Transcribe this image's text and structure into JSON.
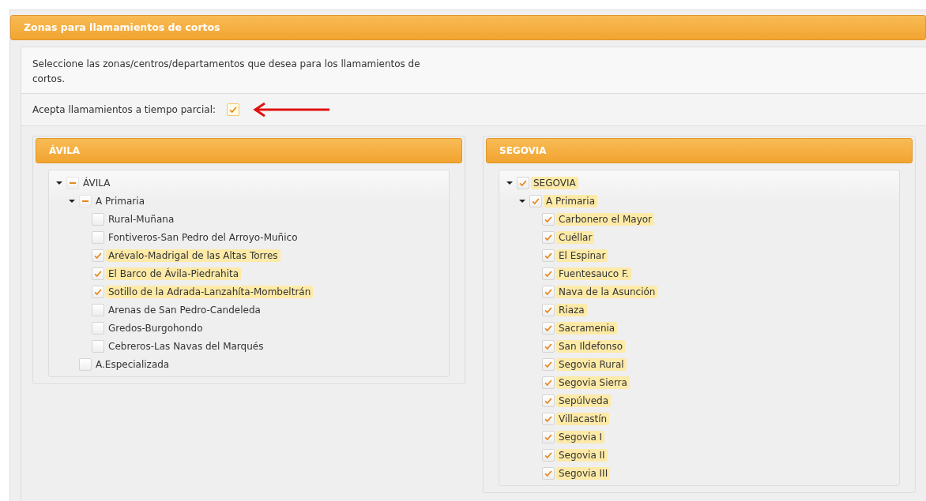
{
  "header": {
    "title": "Zonas para llamamientos de cortos"
  },
  "intro": "Seleccione las zonas/centros/departamentos que desea para los llamamientos de cortos.",
  "partial_time": {
    "label": "Acepta llamamientos a tiempo parcial:",
    "checked": true
  },
  "zones": [
    {
      "title": "ÁVILA",
      "tree": [
        {
          "label": "ÁVILA",
          "checked": false,
          "indeterminate": true,
          "expanded": true,
          "children": [
            {
              "label": "A Primaria",
              "checked": false,
              "indeterminate": true,
              "expanded": true,
              "children": [
                {
                  "label": "Rural-Muñana",
                  "checked": false,
                  "indeterminate": false
                },
                {
                  "label": "Fontiveros-San Pedro del Arroyo-Muñico",
                  "checked": false,
                  "indeterminate": false
                },
                {
                  "label": "Arévalo-Madrigal de las Altas Torres",
                  "checked": true,
                  "indeterminate": false
                },
                {
                  "label": "El Barco de Ávila-Piedrahita",
                  "checked": true,
                  "indeterminate": false
                },
                {
                  "label": "Sotillo de la Adrada-Lanzahíta-Mombeltrán",
                  "checked": true,
                  "indeterminate": false
                },
                {
                  "label": "Arenas de San Pedro-Candeleda",
                  "checked": false,
                  "indeterminate": false
                },
                {
                  "label": "Gredos-Burgohondo",
                  "checked": false,
                  "indeterminate": false
                },
                {
                  "label": "Cebreros-Las Navas del Marqués",
                  "checked": false,
                  "indeterminate": false
                }
              ]
            },
            {
              "label": "A.Especializada",
              "checked": false,
              "indeterminate": false
            }
          ]
        }
      ]
    },
    {
      "title": "SEGOVIA",
      "tree": [
        {
          "label": "SEGOVIA",
          "checked": true,
          "indeterminate": false,
          "expanded": true,
          "children": [
            {
              "label": "A Primaria",
              "checked": true,
              "indeterminate": false,
              "expanded": true,
              "children": [
                {
                  "label": "Carbonero el Mayor",
                  "checked": true,
                  "indeterminate": false
                },
                {
                  "label": "Cuéllar",
                  "checked": true,
                  "indeterminate": false
                },
                {
                  "label": "El Espinar",
                  "checked": true,
                  "indeterminate": false
                },
                {
                  "label": "Fuentesauco F.",
                  "checked": true,
                  "indeterminate": false
                },
                {
                  "label": "Nava de la Asunción",
                  "checked": true,
                  "indeterminate": false
                },
                {
                  "label": "Riaza",
                  "checked": true,
                  "indeterminate": false
                },
                {
                  "label": "Sacramenia",
                  "checked": true,
                  "indeterminate": false
                },
                {
                  "label": "San Ildefonso",
                  "checked": true,
                  "indeterminate": false
                },
                {
                  "label": "Segovia Rural",
                  "checked": true,
                  "indeterminate": false
                },
                {
                  "label": "Segovia Sierra",
                  "checked": true,
                  "indeterminate": false
                },
                {
                  "label": "Sepúlveda",
                  "checked": true,
                  "indeterminate": false
                },
                {
                  "label": "Villacastín",
                  "checked": true,
                  "indeterminate": false
                },
                {
                  "label": "Segovia I",
                  "checked": true,
                  "indeterminate": false
                },
                {
                  "label": "Segovia II",
                  "checked": true,
                  "indeterminate": false
                },
                {
                  "label": "Segovia III",
                  "checked": true,
                  "indeterminate": false
                }
              ]
            }
          ]
        }
      ]
    }
  ]
}
